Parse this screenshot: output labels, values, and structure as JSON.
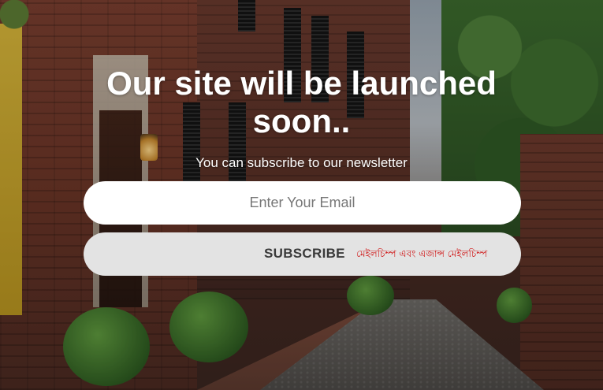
{
  "hero": {
    "headline": "Our site will be launched soon..",
    "subtitle": "You can subscribe to our newsletter"
  },
  "form": {
    "email_placeholder": "Enter Your Email",
    "email_value": "",
    "subscribe_label": "SUBSCRIBE",
    "mailchimp_note": "মেইলচিম্প এবং এজান্স মেইলচিম্প"
  },
  "colors": {
    "headline_text": "#ffffff",
    "input_background": "#ffffff",
    "button_background": "#e3e3e3",
    "button_text": "#3a3a3a",
    "note_text": "#d01818"
  }
}
